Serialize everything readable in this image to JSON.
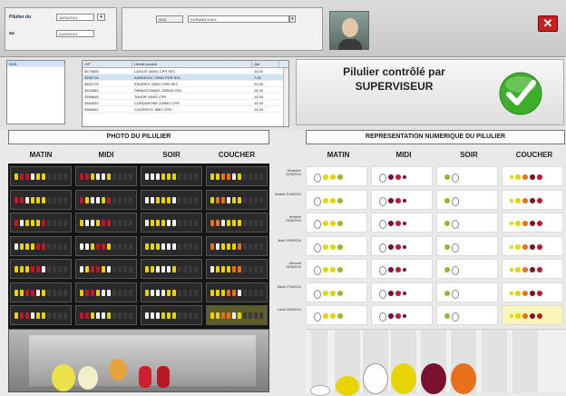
{
  "header": {
    "pilulier_label": "Pilulier du",
    "pilulier_date": "16/06/2014",
    "au_label": "au",
    "au_date": "22/06/2014",
    "resident_id": "0001",
    "resident_name": "DURAND André"
  },
  "meds": {
    "columns": [
      "CIP",
      "Libellé produit",
      "Qté"
    ],
    "rows": [
      {
        "cip": "3670508",
        "name": "LASILIX 40MG CPR SEC",
        "qty": "14,00"
      },
      {
        "cip": "3590716",
        "name": "KARDEGIC 75MG PDR SOL",
        "qty": "7,00"
      },
      {
        "cip": "3602178",
        "name": "ESIDREX 25MG CPR SEC",
        "qty": "21,00"
      },
      {
        "cip": "3516854",
        "name": "PARACETAMOL 500MG GEL",
        "qty": "14,00"
      },
      {
        "cip": "3399648",
        "name": "TAHOR 10MG CPR",
        "qty": "14,00"
      },
      {
        "cip": "3563033",
        "name": "CORDARONE 200MG CPR",
        "qty": "14,00"
      },
      {
        "cip": "3584942",
        "name": "COVERSYL 5MG CPR",
        "qty": "14,00"
      }
    ]
  },
  "status": {
    "line1": "Pilulier contrôlé par",
    "line2": "SUPERVISEUR"
  },
  "photo_section": {
    "title": "PHOTO DU PILULIER",
    "cols": [
      "MATIN",
      "MIDI",
      "SOIR",
      "COUCHER"
    ]
  },
  "numeric_section": {
    "title": "REPRESENTATION NUMERIQUE DU PILULIER",
    "cols": [
      "MATIN",
      "MIDI",
      "SOIR",
      "COUCHER"
    ],
    "days": [
      {
        "name": "Dimanche",
        "date": "22/06/2014"
      },
      {
        "name": "Samedi",
        "date": "21/06/2014"
      },
      {
        "name": "Vendredi",
        "date": "20/06/2014"
      },
      {
        "name": "Jeudi",
        "date": "19/06/2014"
      },
      {
        "name": "Mercredi",
        "date": "18/06/2014"
      },
      {
        "name": "Mardi",
        "date": "17/06/2014"
      },
      {
        "name": "Lundi",
        "date": "16/06/2014"
      }
    ]
  },
  "colors": {
    "check_green": "#3cae2a",
    "close_red": "#c8201f",
    "pill_yellow": "#e8d400",
    "pill_red": "#c0182a",
    "pill_purple": "#7a1030",
    "pill_orange": "#e8701a"
  },
  "icons": [
    "check-icon",
    "close-icon",
    "dropdown-icon",
    "calendar-icon"
  ]
}
